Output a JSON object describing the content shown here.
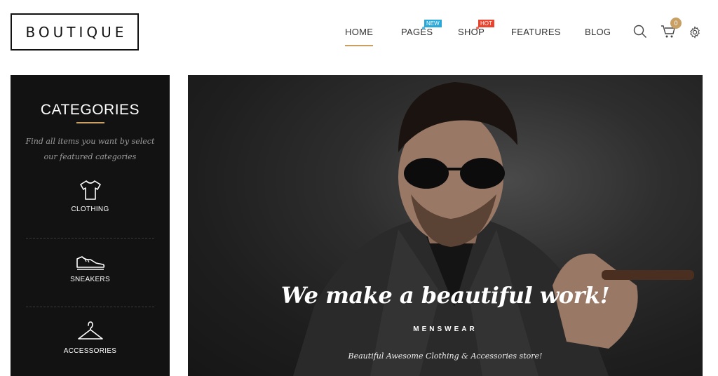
{
  "header": {
    "logo": "BOUTIQUE",
    "nav": [
      {
        "label": "HOME",
        "active": true
      },
      {
        "label": "PAGES",
        "badge": "NEW"
      },
      {
        "label": "SHOP",
        "badge": "HOT"
      },
      {
        "label": "FEATURES"
      },
      {
        "label": "BLOG"
      }
    ],
    "cart_count": "0",
    "colors": {
      "accent": "#c9a063",
      "badge_new": "#2aa8d8",
      "badge_hot": "#e8432e"
    },
    "icons": [
      "search-icon",
      "cart-icon",
      "settings-gear-icon"
    ]
  },
  "sidebar": {
    "title": "CATEGORIES",
    "description": "Find all items you want by select our featured categories",
    "categories": [
      {
        "label": "CLOTHING",
        "icon": "tshirt-icon"
      },
      {
        "label": "SNEAKERS",
        "icon": "sneaker-icon"
      },
      {
        "label": "ACCESSORIES",
        "icon": "hanger-icon"
      }
    ]
  },
  "hero": {
    "tagline": "We make a beautiful work!",
    "subtitle": "MENSWEAR",
    "caption": "Beautiful Awesome Clothing & Accessories store!"
  }
}
